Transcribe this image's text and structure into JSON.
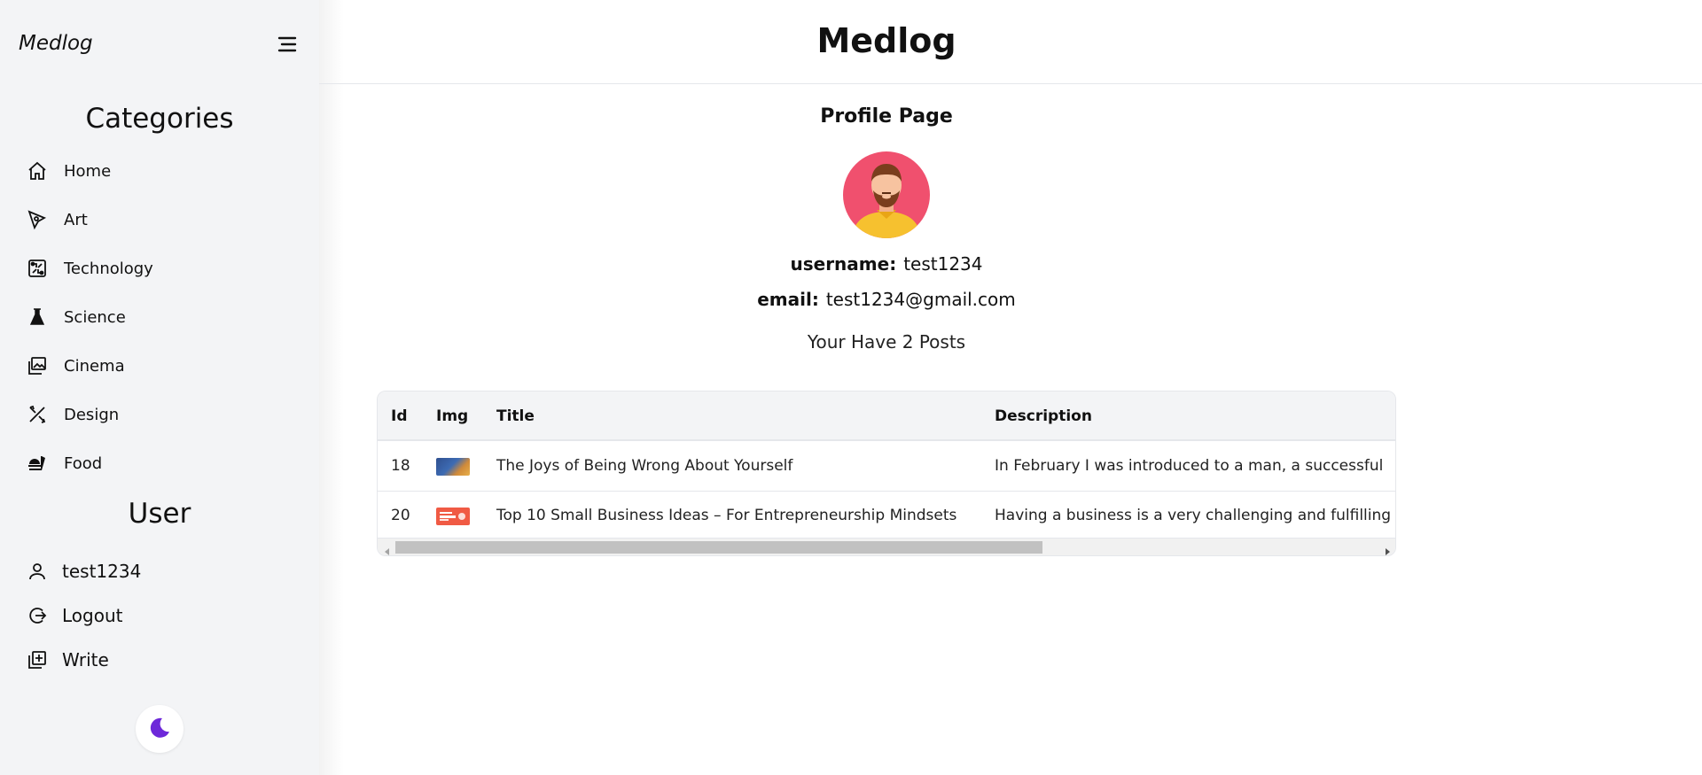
{
  "sidebar": {
    "brand": "Medlog",
    "menu_icon": "menu-icon",
    "categories_title": "Categories",
    "categories": [
      {
        "label": "Home",
        "icon": "home-icon"
      },
      {
        "label": "Art",
        "icon": "pen-tool-icon"
      },
      {
        "label": "Technology",
        "icon": "circuit-icon"
      },
      {
        "label": "Science",
        "icon": "flask-icon"
      },
      {
        "label": "Cinema",
        "icon": "images-icon"
      },
      {
        "label": "Design",
        "icon": "design-tools-icon"
      },
      {
        "label": "Food",
        "icon": "food-icon"
      }
    ],
    "user_title": "User",
    "user_items": [
      {
        "label": "test1234",
        "icon": "user-icon"
      },
      {
        "label": "Logout",
        "icon": "logout-icon"
      },
      {
        "label": "Write",
        "icon": "write-icon"
      }
    ],
    "theme_toggle_icon": "moon-stars-icon",
    "theme_color": "#6d28d9"
  },
  "header": {
    "title": "Medlog"
  },
  "profile": {
    "page_title": "Profile Page",
    "username_label": "username:",
    "username": "test1234",
    "email_label": "email:",
    "email": "test1234@gmail.com",
    "posts_text": "Your Have 2 Posts"
  },
  "table": {
    "columns": [
      "Id",
      "Img",
      "Title",
      "Description"
    ],
    "rows": [
      {
        "id": "18",
        "img_color": "#3b5b9a",
        "title": "The Joys of Being Wrong About Yourself",
        "description": "In February I was introduced to a man, a successful"
      },
      {
        "id": "20",
        "img_color": "#f05a44",
        "title": "Top 10 Small Business Ideas – For Entrepreneurship Mindsets",
        "description": "Having a business is a very challenging and fulfilling"
      }
    ]
  }
}
